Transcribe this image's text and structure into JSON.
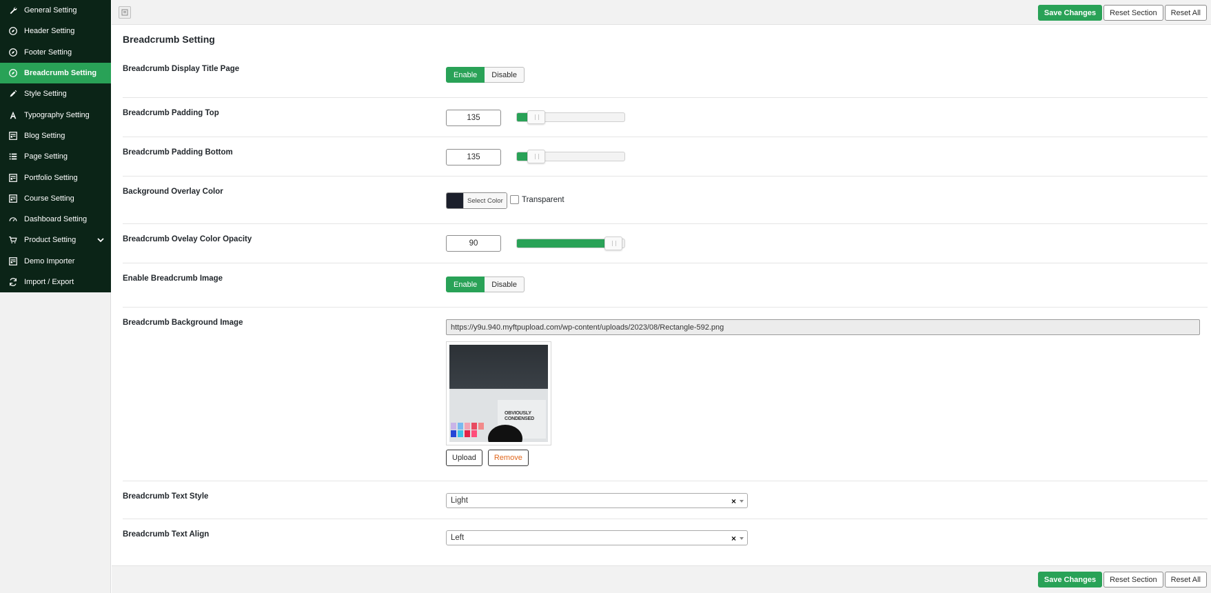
{
  "sidebar": {
    "items": [
      {
        "label": "General Setting",
        "icon": "wrench-icon"
      },
      {
        "label": "Header Setting",
        "icon": "compass-icon"
      },
      {
        "label": "Footer Setting",
        "icon": "compass-icon"
      },
      {
        "label": "Breadcrumb Setting",
        "icon": "compass-icon",
        "active": true
      },
      {
        "label": "Style Setting",
        "icon": "pencil-icon"
      },
      {
        "label": "Typography Setting",
        "icon": "font-icon"
      },
      {
        "label": "Blog Setting",
        "icon": "layout-icon"
      },
      {
        "label": "Page Setting",
        "icon": "list-icon"
      },
      {
        "label": "Portfolio Setting",
        "icon": "layout-icon"
      },
      {
        "label": "Course Setting",
        "icon": "layout-icon"
      },
      {
        "label": "Dashboard Setting",
        "icon": "gauge-icon"
      },
      {
        "label": "Product Setting",
        "icon": "cart-icon",
        "expandable": true
      },
      {
        "label": "Demo Importer",
        "icon": "layout-icon"
      },
      {
        "label": "Import / Export",
        "icon": "refresh-icon"
      }
    ]
  },
  "toolbar": {
    "save_label": "Save Changes",
    "reset_section_label": "Reset Section",
    "reset_all_label": "Reset All"
  },
  "section": {
    "title": "Breadcrumb Setting"
  },
  "fields": {
    "display_title": {
      "label": "Breadcrumb Display Title Page",
      "on_label": "Enable",
      "off_label": "Disable",
      "value": "Enable"
    },
    "padding_top": {
      "label": "Breadcrumb Padding Top",
      "value": "135",
      "slider_fraction": 0.18
    },
    "padding_bottom": {
      "label": "Breadcrumb Padding Bottom",
      "value": "135",
      "slider_fraction": 0.18
    },
    "overlay_color": {
      "label": "Background Overlay Color",
      "button_label": "Select Color",
      "color": "#1b1f2b",
      "transparent_label": "Transparent",
      "transparent_checked": false
    },
    "overlay_opacity": {
      "label": "Breadcrumb Ovelay Color Opacity",
      "value": "90",
      "slider_fraction": 0.9
    },
    "enable_image": {
      "label": "Enable Breadcrumb Image",
      "on_label": "Enable",
      "off_label": "Disable",
      "value": "Enable"
    },
    "bg_image": {
      "label": "Breadcrumb Background Image",
      "url": "https://y9u.940.myftpupload.com/wp-content/uploads/2023/08/Rectangle-592.png",
      "upload_label": "Upload",
      "remove_label": "Remove",
      "thumb_text": "OBVIOUSLY\nCONDENSED"
    },
    "text_style": {
      "label": "Breadcrumb Text Style",
      "value": "Light"
    },
    "text_align": {
      "label": "Breadcrumb Text Align",
      "value": "Left"
    }
  },
  "colors": {
    "accent": "#29a257",
    "sidebar_bg": "#0b2417",
    "danger": "#e0661c"
  }
}
